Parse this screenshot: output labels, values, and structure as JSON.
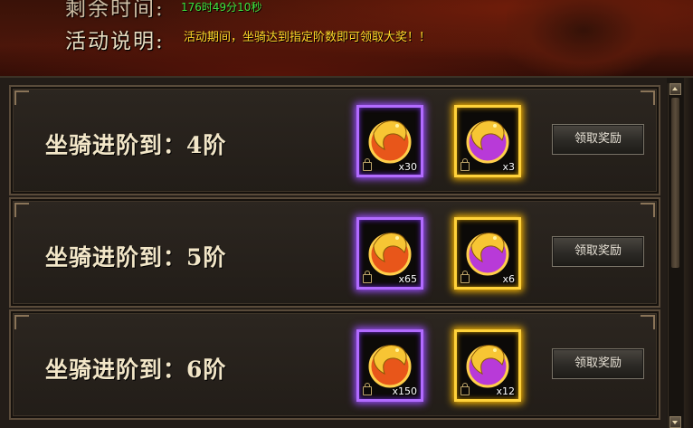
{
  "header": {
    "remaining_label": "剩余时间:",
    "remaining_value": "176时49分10秒",
    "desc_label": "活动说明:",
    "desc_value": "活动期间，坐骑达到指定阶数即可领取大奖！！"
  },
  "rows": [
    {
      "title": "坐骑进阶到：4阶",
      "items": [
        {
          "icon": "golden-dragon-orb-icon",
          "quality": "purple",
          "qty": "x30"
        },
        {
          "icon": "purple-dragon-orb-icon",
          "quality": "gold",
          "qty": "x3"
        }
      ],
      "button": "领取奖励"
    },
    {
      "title": "坐骑进阶到：5阶",
      "items": [
        {
          "icon": "golden-dragon-orb-icon",
          "quality": "purple",
          "qty": "x65"
        },
        {
          "icon": "purple-dragon-orb-icon",
          "quality": "gold",
          "qty": "x6"
        }
      ],
      "button": "领取奖励"
    },
    {
      "title": "坐骑进阶到：6阶",
      "items": [
        {
          "icon": "golden-dragon-orb-icon",
          "quality": "purple",
          "qty": "x150"
        },
        {
          "icon": "purple-dragon-orb-icon",
          "quality": "gold",
          "qty": "x12"
        }
      ],
      "button": "领取奖励"
    }
  ],
  "colors": {
    "timer_green": "#3ee23e",
    "desc_yellow": "#ffd92a",
    "purple_frame": "#b26bff",
    "gold_frame": "#ffd23a"
  }
}
